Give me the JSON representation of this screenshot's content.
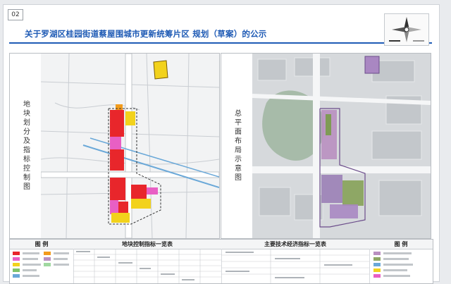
{
  "page_number": "02",
  "title": "关于罗湖区桂园街道蔡屋围城市更新统筹片区 规划（草案）的公示",
  "panels": {
    "left_label": "地块划分及指标控制图",
    "right_label": "总平面布局示意图"
  },
  "bottom": {
    "legend_left": "图  例",
    "table_left": "地块控制指标一览表",
    "table_right": "主要技术经济指标一览表",
    "legend_right": "图  例"
  },
  "colors": {
    "accent_blue": "#1f5bb5",
    "residential_red": "#e8262b",
    "commercial_magenta": "#e85fc4",
    "public_yellow": "#f2d21c",
    "road_blue": "#6aa8d8"
  }
}
